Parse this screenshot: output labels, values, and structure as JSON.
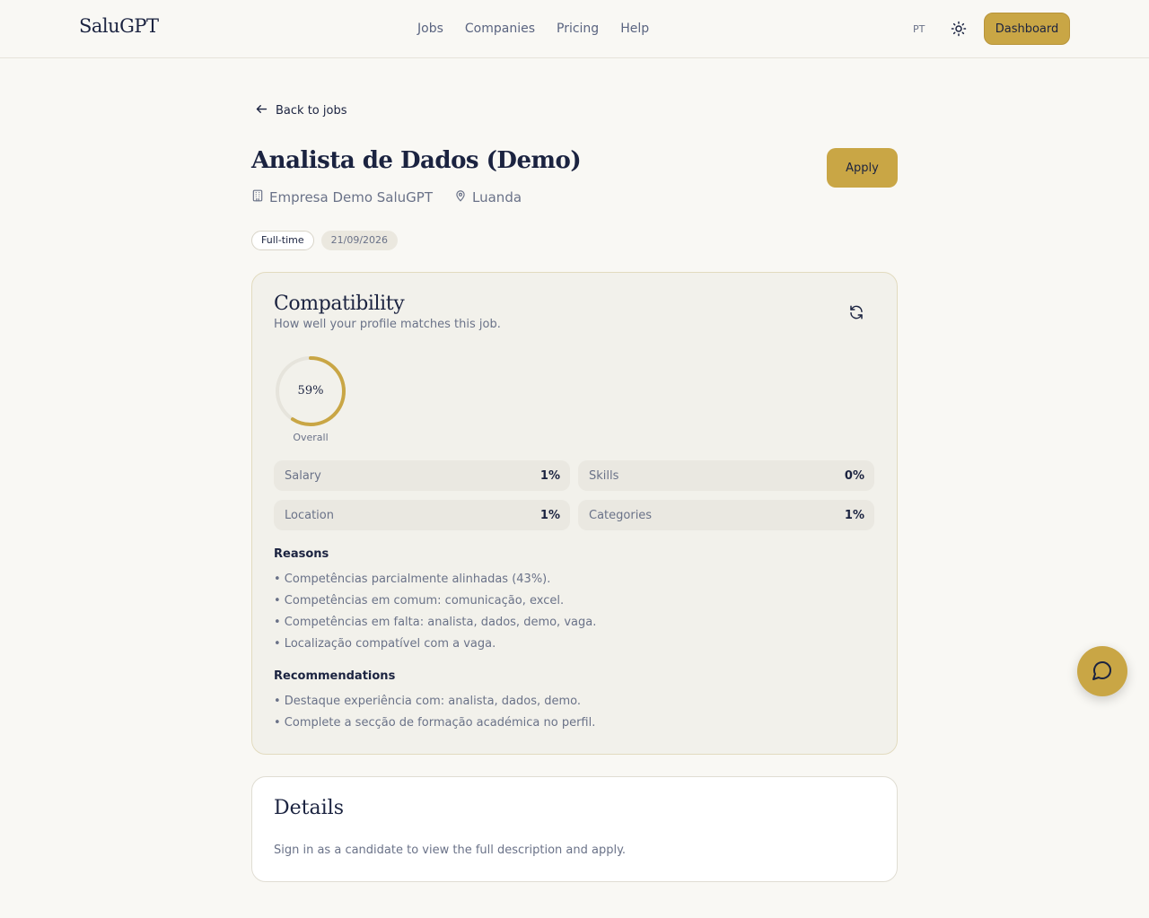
{
  "brand": {
    "name": "SaluGPT"
  },
  "nav": {
    "items": [
      {
        "label": "Jobs"
      },
      {
        "label": "Companies"
      },
      {
        "label": "Pricing"
      },
      {
        "label": "Help"
      }
    ],
    "lang": "PT",
    "theme_icon": "sun-icon",
    "dashboard_label": "Dashboard"
  },
  "back": {
    "label": "Back to jobs",
    "icon": "arrow-left-icon"
  },
  "job": {
    "title": "Analista de Dados (Demo)",
    "company": "Empresa Demo SaluGPT",
    "company_icon": "building-icon",
    "location": "Luanda",
    "location_icon": "map-pin-icon",
    "apply_label": "Apply",
    "tags": [
      "Full-time",
      "21/09/2026"
    ]
  },
  "compatibility": {
    "title": "Compatibility",
    "subtitle": "How well your profile matches this job.",
    "refresh_icon": "refresh-icon",
    "overall_percent": 59,
    "overall_text": "59%",
    "overall_label": "Overall",
    "metrics": [
      {
        "label": "Salary",
        "value": "1%"
      },
      {
        "label": "Skills",
        "value": "0%"
      },
      {
        "label": "Location",
        "value": "1%"
      },
      {
        "label": "Categories",
        "value": "1%"
      }
    ],
    "reasons_title": "Reasons",
    "reasons": [
      "• Competências parcialmente alinhadas (43%).",
      "• Competências em comum: comunicação, excel.",
      "• Competências em falta: analista, dados, demo, vaga.",
      "• Localização compatível com a vaga."
    ],
    "recommendations_title": "Recommendations",
    "recommendations": [
      "• Destaque experiência com: analista, dados, demo.",
      "• Complete a secção de formação académica no perfil."
    ]
  },
  "details": {
    "title": "Details",
    "text": "Sign in as a candidate to view the full description and apply."
  },
  "chat": {
    "icon": "chat-bubble-icon"
  },
  "colors": {
    "accent": "#c9a645",
    "text": "#1b2340",
    "muted": "#6a7288",
    "background": "#f9f8f4"
  }
}
